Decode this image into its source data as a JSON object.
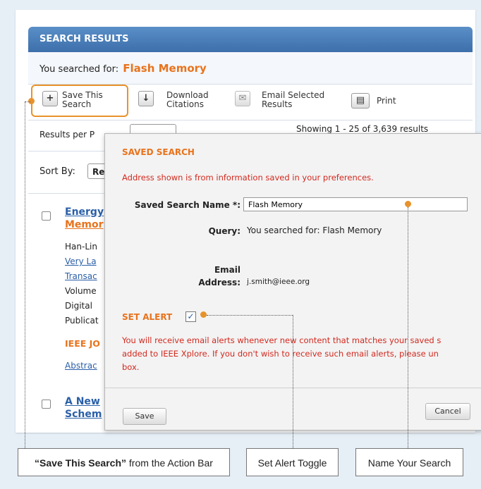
{
  "header": {
    "title": "SEARCH RESULTS"
  },
  "searched": {
    "prefix": "You searched for:",
    "query": "Flash Memory"
  },
  "actions": {
    "save": {
      "label1": "Save This",
      "label2": "Search",
      "icon": "plus-icon"
    },
    "download": {
      "label1": "Download",
      "label2": "Citations",
      "icon": "down-arrow-icon"
    },
    "email": {
      "label1": "Email Selected",
      "label2": "Results",
      "icon": "envelope-icon"
    },
    "print": {
      "label": "Print",
      "icon": "printer-icon"
    }
  },
  "results_bar": {
    "per_page_label": "Results per P",
    "showing": "Showing 1 - 25 of 3,639 results"
  },
  "sort": {
    "label": "Sort By:",
    "value": "Re"
  },
  "results": [
    {
      "title1": "Energy",
      "title2": "Memor",
      "author": "Han-Lin",
      "link1": "Very La",
      "link2": "Transac",
      "line1": "Volume",
      "line2": "Digital ",
      "line3": "Publicat",
      "publisher": "IEEE JO",
      "abstract": "Abstrac"
    },
    {
      "title1": "A New",
      "title2": "Schem"
    }
  ],
  "modal": {
    "title": "SAVED SEARCH",
    "notice": "Address shown is from information saved in your preferences.",
    "name_label": "Saved Search Name *:",
    "name_value": "Flash Memory",
    "query_label": "Query:",
    "query_value": "You searched for: Flash Memory",
    "email_label1": "Email",
    "email_label2": "Address:",
    "email_value": "j.smith@ieee.org",
    "alert_label": "SET ALERT",
    "alert_checked": true,
    "alert_text1": "You will receive email alerts whenever new content that matches your saved s",
    "alert_text2": "added to IEEE Xplore. If you don't wish to receive such email alerts, please un",
    "alert_text3": "box.",
    "save_button": "Save",
    "cancel_button": "Cancel"
  },
  "callouts": {
    "save_search_bold": "“Save This Search”",
    "save_search_rest": " from the Action Bar",
    "set_alert": "Set Alert Toggle",
    "name_search": "Name Your Search"
  },
  "colors": {
    "accent": "#e8731d",
    "header": "#4a7fbd",
    "alert_red": "#d12a1f"
  }
}
